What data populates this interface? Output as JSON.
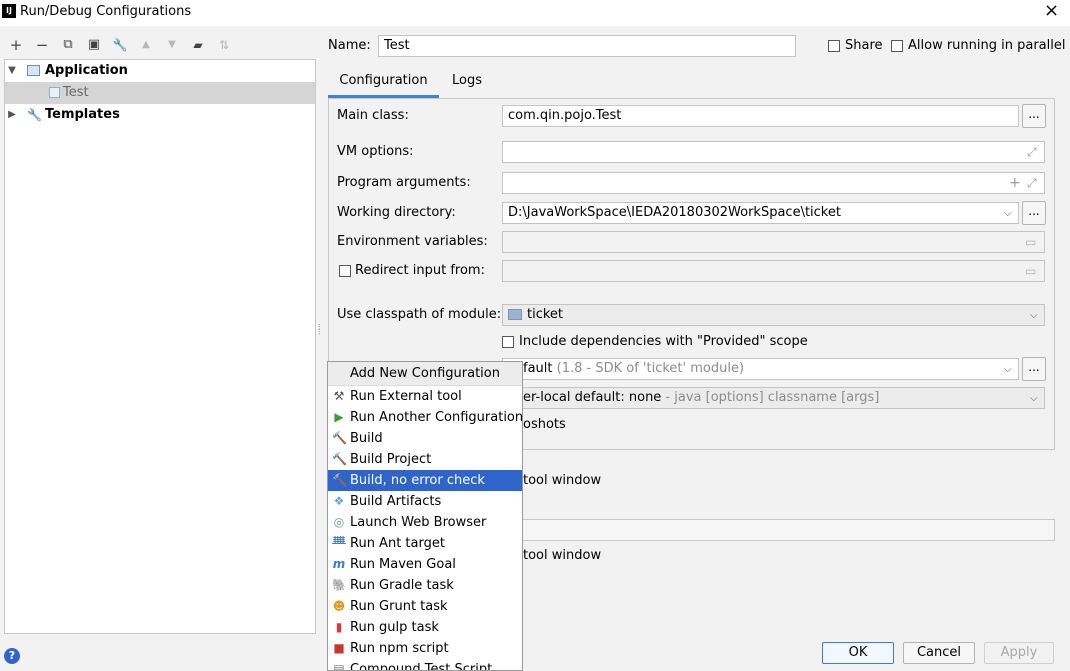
{
  "window": {
    "title": "Run/Debug Configurations",
    "app_icon": "IJ",
    "close": "×"
  },
  "toolbar": [
    {
      "name": "add-icon",
      "glyph": "+"
    },
    {
      "name": "remove-icon",
      "glyph": "−"
    },
    {
      "name": "copy-icon",
      "glyph": "⧉"
    },
    {
      "name": "save-icon",
      "glyph": "▣"
    },
    {
      "name": "wrench-icon",
      "glyph": "🔧"
    },
    {
      "name": "move-up-icon",
      "glyph": "▲"
    },
    {
      "name": "move-down-icon",
      "glyph": "▼"
    },
    {
      "name": "folder-add-icon",
      "glyph": "▰"
    },
    {
      "name": "sort-icon",
      "glyph": "⇅"
    }
  ],
  "tree": {
    "items": [
      {
        "label": "Application",
        "expanded": true
      },
      {
        "label": "Test",
        "selected": true
      },
      {
        "label": "Templates",
        "expanded": false
      }
    ]
  },
  "name_row": {
    "label": "Name:",
    "value": "Test",
    "share_label": "Share",
    "parallel_label": "Allow running in parallel"
  },
  "tabs": {
    "configuration": "Configuration",
    "logs": "Logs"
  },
  "config": {
    "main_class_label": "Main class:",
    "main_class_value": "com.qin.pojo.Test",
    "vm_options_label": "VM options:",
    "program_args_label": "Program arguments:",
    "working_dir_label": "Working directory:",
    "working_dir_value": "D:\\JavaWorkSpace\\IEDA20180302WorkSpace\\ticket",
    "env_vars_label": "Environment variables:",
    "redirect_label": "Redirect input from:",
    "classpath_label": "Use classpath of module:",
    "classpath_value": "ticket",
    "include_deps_label": "Include dependencies with \"Provided\" scope",
    "jre_value_main": "fault",
    "jre_value_hint": "(1.8 - SDK of 'ticket' module)",
    "shorten_value_main": "er-local default: none",
    "shorten_value_hint": "- java [options] classname [args]",
    "snapshots_text": "oshots",
    "tool_window_1": "tool window",
    "tool_window_2": "tool window",
    "dots": "..."
  },
  "popup": {
    "header": "Add New Configuration",
    "items": [
      {
        "label": "Run External tool",
        "icon": "tools-icon",
        "glyph": "⚒",
        "color": "#555555"
      },
      {
        "label": "Run Another Configuration",
        "icon": "run-icon",
        "glyph": "▶",
        "color": "#3f9a3a"
      },
      {
        "label": "Build",
        "icon": "hammer-icon",
        "glyph": "🔨",
        "color": "#3f9a3a"
      },
      {
        "label": "Build Project",
        "icon": "hammer-icon",
        "glyph": "🔨",
        "color": "#3f9a3a"
      },
      {
        "label": "Build, no error check",
        "icon": "hammer-icon",
        "glyph": "🔨",
        "color": "#3f9a3a",
        "selected": true
      },
      {
        "label": "Build Artifacts",
        "icon": "artifacts-icon",
        "glyph": "❖",
        "color": "#5fa3dc"
      },
      {
        "label": "Launch Web Browser",
        "icon": "globe-icon",
        "glyph": "◎",
        "color": "#6a8fb0"
      },
      {
        "label": "Run Ant target",
        "icon": "ant-icon",
        "glyph": "ᚙ",
        "color": "#4a7bb5"
      },
      {
        "label": "Run Maven Goal",
        "icon": "maven-icon",
        "glyph": "m",
        "color": "#3a7bd5"
      },
      {
        "label": "Run Gradle task",
        "icon": "gradle-icon",
        "glyph": "🐘",
        "color": "#6a6a6a"
      },
      {
        "label": "Run Grunt task",
        "icon": "grunt-icon",
        "glyph": "☻",
        "color": "#e09a20"
      },
      {
        "label": "Run gulp task",
        "icon": "gulp-icon",
        "glyph": "▮",
        "color": "#d83a3a"
      },
      {
        "label": "Run npm script",
        "icon": "npm-icon",
        "glyph": "■",
        "color": "#c8352a"
      },
      {
        "label": "Compound Test Script",
        "icon": "compound-icon",
        "glyph": "▤",
        "color": "#7a7a7a"
      }
    ]
  },
  "buttons": {
    "ok": "OK",
    "cancel": "Cancel",
    "apply": "Apply",
    "help": "?"
  }
}
